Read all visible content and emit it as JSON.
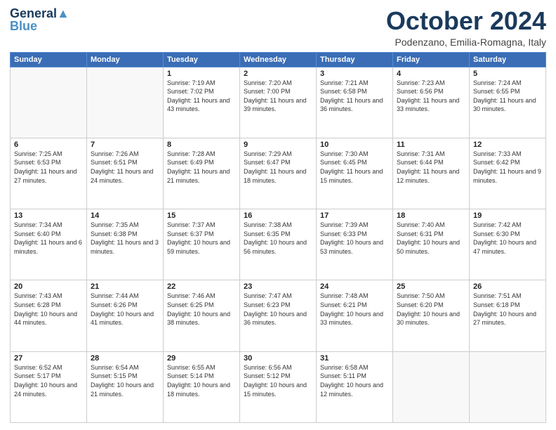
{
  "logo": {
    "line1": "General",
    "line2": "Blue"
  },
  "header": {
    "month": "October 2024",
    "location": "Podenzano, Emilia-Romagna, Italy"
  },
  "weekdays": [
    "Sunday",
    "Monday",
    "Tuesday",
    "Wednesday",
    "Thursday",
    "Friday",
    "Saturday"
  ],
  "weeks": [
    [
      {
        "day": "",
        "sunrise": "",
        "sunset": "",
        "daylight": ""
      },
      {
        "day": "",
        "sunrise": "",
        "sunset": "",
        "daylight": ""
      },
      {
        "day": "1",
        "sunrise": "Sunrise: 7:19 AM",
        "sunset": "Sunset: 7:02 PM",
        "daylight": "Daylight: 11 hours and 43 minutes."
      },
      {
        "day": "2",
        "sunrise": "Sunrise: 7:20 AM",
        "sunset": "Sunset: 7:00 PM",
        "daylight": "Daylight: 11 hours and 39 minutes."
      },
      {
        "day": "3",
        "sunrise": "Sunrise: 7:21 AM",
        "sunset": "Sunset: 6:58 PM",
        "daylight": "Daylight: 11 hours and 36 minutes."
      },
      {
        "day": "4",
        "sunrise": "Sunrise: 7:23 AM",
        "sunset": "Sunset: 6:56 PM",
        "daylight": "Daylight: 11 hours and 33 minutes."
      },
      {
        "day": "5",
        "sunrise": "Sunrise: 7:24 AM",
        "sunset": "Sunset: 6:55 PM",
        "daylight": "Daylight: 11 hours and 30 minutes."
      }
    ],
    [
      {
        "day": "6",
        "sunrise": "Sunrise: 7:25 AM",
        "sunset": "Sunset: 6:53 PM",
        "daylight": "Daylight: 11 hours and 27 minutes."
      },
      {
        "day": "7",
        "sunrise": "Sunrise: 7:26 AM",
        "sunset": "Sunset: 6:51 PM",
        "daylight": "Daylight: 11 hours and 24 minutes."
      },
      {
        "day": "8",
        "sunrise": "Sunrise: 7:28 AM",
        "sunset": "Sunset: 6:49 PM",
        "daylight": "Daylight: 11 hours and 21 minutes."
      },
      {
        "day": "9",
        "sunrise": "Sunrise: 7:29 AM",
        "sunset": "Sunset: 6:47 PM",
        "daylight": "Daylight: 11 hours and 18 minutes."
      },
      {
        "day": "10",
        "sunrise": "Sunrise: 7:30 AM",
        "sunset": "Sunset: 6:45 PM",
        "daylight": "Daylight: 11 hours and 15 minutes."
      },
      {
        "day": "11",
        "sunrise": "Sunrise: 7:31 AM",
        "sunset": "Sunset: 6:44 PM",
        "daylight": "Daylight: 11 hours and 12 minutes."
      },
      {
        "day": "12",
        "sunrise": "Sunrise: 7:33 AM",
        "sunset": "Sunset: 6:42 PM",
        "daylight": "Daylight: 11 hours and 9 minutes."
      }
    ],
    [
      {
        "day": "13",
        "sunrise": "Sunrise: 7:34 AM",
        "sunset": "Sunset: 6:40 PM",
        "daylight": "Daylight: 11 hours and 6 minutes."
      },
      {
        "day": "14",
        "sunrise": "Sunrise: 7:35 AM",
        "sunset": "Sunset: 6:38 PM",
        "daylight": "Daylight: 11 hours and 3 minutes."
      },
      {
        "day": "15",
        "sunrise": "Sunrise: 7:37 AM",
        "sunset": "Sunset: 6:37 PM",
        "daylight": "Daylight: 10 hours and 59 minutes."
      },
      {
        "day": "16",
        "sunrise": "Sunrise: 7:38 AM",
        "sunset": "Sunset: 6:35 PM",
        "daylight": "Daylight: 10 hours and 56 minutes."
      },
      {
        "day": "17",
        "sunrise": "Sunrise: 7:39 AM",
        "sunset": "Sunset: 6:33 PM",
        "daylight": "Daylight: 10 hours and 53 minutes."
      },
      {
        "day": "18",
        "sunrise": "Sunrise: 7:40 AM",
        "sunset": "Sunset: 6:31 PM",
        "daylight": "Daylight: 10 hours and 50 minutes."
      },
      {
        "day": "19",
        "sunrise": "Sunrise: 7:42 AM",
        "sunset": "Sunset: 6:30 PM",
        "daylight": "Daylight: 10 hours and 47 minutes."
      }
    ],
    [
      {
        "day": "20",
        "sunrise": "Sunrise: 7:43 AM",
        "sunset": "Sunset: 6:28 PM",
        "daylight": "Daylight: 10 hours and 44 minutes."
      },
      {
        "day": "21",
        "sunrise": "Sunrise: 7:44 AM",
        "sunset": "Sunset: 6:26 PM",
        "daylight": "Daylight: 10 hours and 41 minutes."
      },
      {
        "day": "22",
        "sunrise": "Sunrise: 7:46 AM",
        "sunset": "Sunset: 6:25 PM",
        "daylight": "Daylight: 10 hours and 38 minutes."
      },
      {
        "day": "23",
        "sunrise": "Sunrise: 7:47 AM",
        "sunset": "Sunset: 6:23 PM",
        "daylight": "Daylight: 10 hours and 36 minutes."
      },
      {
        "day": "24",
        "sunrise": "Sunrise: 7:48 AM",
        "sunset": "Sunset: 6:21 PM",
        "daylight": "Daylight: 10 hours and 33 minutes."
      },
      {
        "day": "25",
        "sunrise": "Sunrise: 7:50 AM",
        "sunset": "Sunset: 6:20 PM",
        "daylight": "Daylight: 10 hours and 30 minutes."
      },
      {
        "day": "26",
        "sunrise": "Sunrise: 7:51 AM",
        "sunset": "Sunset: 6:18 PM",
        "daylight": "Daylight: 10 hours and 27 minutes."
      }
    ],
    [
      {
        "day": "27",
        "sunrise": "Sunrise: 6:52 AM",
        "sunset": "Sunset: 5:17 PM",
        "daylight": "Daylight: 10 hours and 24 minutes."
      },
      {
        "day": "28",
        "sunrise": "Sunrise: 6:54 AM",
        "sunset": "Sunset: 5:15 PM",
        "daylight": "Daylight: 10 hours and 21 minutes."
      },
      {
        "day": "29",
        "sunrise": "Sunrise: 6:55 AM",
        "sunset": "Sunset: 5:14 PM",
        "daylight": "Daylight: 10 hours and 18 minutes."
      },
      {
        "day": "30",
        "sunrise": "Sunrise: 6:56 AM",
        "sunset": "Sunset: 5:12 PM",
        "daylight": "Daylight: 10 hours and 15 minutes."
      },
      {
        "day": "31",
        "sunrise": "Sunrise: 6:58 AM",
        "sunset": "Sunset: 5:11 PM",
        "daylight": "Daylight: 10 hours and 12 minutes."
      },
      {
        "day": "",
        "sunrise": "",
        "sunset": "",
        "daylight": ""
      },
      {
        "day": "",
        "sunrise": "",
        "sunset": "",
        "daylight": ""
      }
    ]
  ]
}
